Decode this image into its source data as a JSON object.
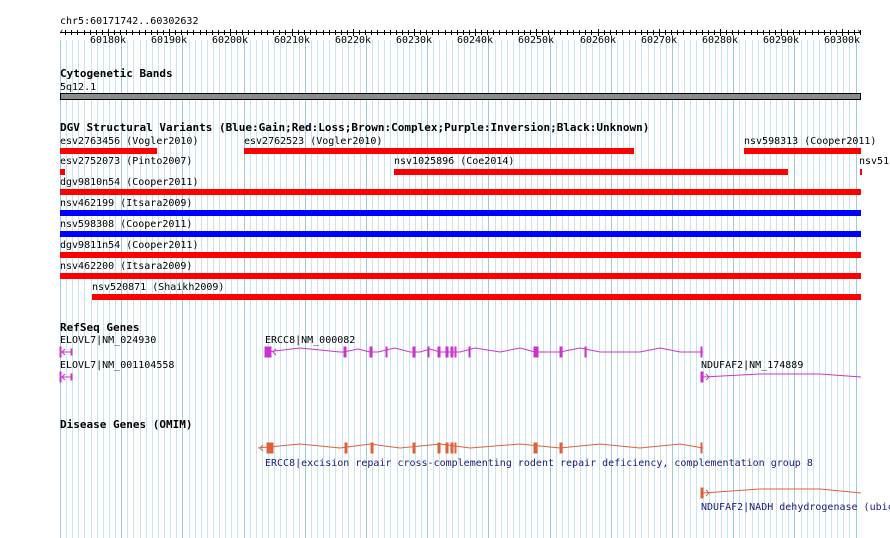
{
  "ruler": {
    "position": "chr5:60171742..60302632",
    "ticks": [
      "60180k",
      "60190k",
      "60200k",
      "60210k",
      "60220k",
      "60230k",
      "60240k",
      "60250k",
      "60260k",
      "60270k",
      "60280k",
      "60290k",
      "60300k"
    ]
  },
  "cytogenetic": {
    "title": "Cytogenetic Bands",
    "band": "5q12.1"
  },
  "dgv": {
    "title": "DGV Structural Variants (Blue:Gain;Red:Loss;Brown:Complex;Purple:Inversion;Black:Unknown)",
    "colors": {
      "gain": "#0000ff",
      "loss": "#ff0000"
    },
    "variants": [
      {
        "label": "esv2763456 (Vogler2010)",
        "type": "loss"
      },
      {
        "label": "esv2762523 (Vogler2010)",
        "type": "loss"
      },
      {
        "label": "nsv598313 (Cooper2011)",
        "type": "loss"
      },
      {
        "label": "esv2752073 (Pinto2007)",
        "type": "loss"
      },
      {
        "label": "nsv1025896 (Coe2014)",
        "type": "loss"
      },
      {
        "label": "nsv51",
        "type": "loss"
      },
      {
        "label": "dgv9810n54 (Cooper2011)",
        "type": "loss"
      },
      {
        "label": "nsv462199 (Itsara2009)",
        "type": "gain"
      },
      {
        "label": "nsv598308 (Cooper2011)",
        "type": "gain"
      },
      {
        "label": "dgv9811n54 (Cooper2011)",
        "type": "loss"
      },
      {
        "label": "nsv462200 (Itsara2009)",
        "type": "loss"
      },
      {
        "label": "nsv520871 (Shaikh2009)",
        "type": "loss"
      }
    ]
  },
  "refseq": {
    "title": "RefSeq Genes",
    "color": "#cc33cc",
    "genes": [
      {
        "label": "ELOVL7|NM_024930"
      },
      {
        "label": "ERCC8|NM_000082"
      },
      {
        "label": "ELOVL7|NM_001104558"
      },
      {
        "label": "NDUFAF2|NM_174889"
      }
    ]
  },
  "omim": {
    "title": "Disease Genes (OMIM)",
    "color": "#e0603a",
    "label_color": "#1a1a7a",
    "genes": [
      {
        "label": "ERCC8|excision repair cross-complementing rodent repair deficiency, complementation group 8"
      },
      {
        "label": "NDUFAF2|NADH dehydrogenase (ubic"
      }
    ]
  }
}
